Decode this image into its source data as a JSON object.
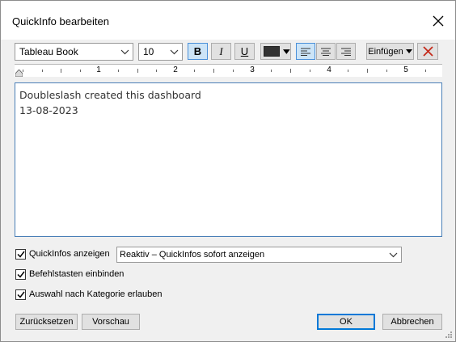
{
  "window": {
    "title": "QuickInfo bearbeiten"
  },
  "toolbar": {
    "font_family": "Tableau Book",
    "font_size": "10",
    "bold_label": "B",
    "italic_label": "I",
    "underline_label": "U",
    "text_color": "#333333",
    "insert_label": "Einfügen",
    "alignment_selected": "left"
  },
  "ruler": {
    "marks": [
      "1",
      "2",
      "3",
      "4",
      "5"
    ]
  },
  "editor": {
    "lines": [
      "Doubleslash created this dashboard",
      "13-08-2023"
    ]
  },
  "options": {
    "show_tooltips_label": "QuickInfos anzeigen",
    "show_tooltips_checked": true,
    "tooltip_mode_value": "Reaktiv – QuickInfos sofort anzeigen",
    "include_commands_label": "Befehlstasten einbinden",
    "include_commands_checked": true,
    "allow_category_label": "Auswahl nach Kategorie erlauben",
    "allow_category_checked": true
  },
  "buttons": {
    "reset_label": "Zurücksetzen",
    "preview_label": "Vorschau",
    "ok_label": "OK",
    "cancel_label": "Abbrechen"
  },
  "colors": {
    "accent": "#0078d7",
    "delete_red": "#c42b1c"
  }
}
